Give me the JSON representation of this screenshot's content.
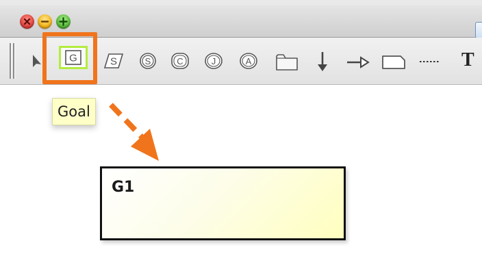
{
  "window": {
    "controls": [
      {
        "name": "close",
        "color": "#e0443e"
      },
      {
        "name": "minimize",
        "color": "#f4b41a"
      },
      {
        "name": "zoom",
        "color": "#5ab93a"
      }
    ]
  },
  "toolbar": {
    "tools": [
      {
        "name": "pointer",
        "icon": "pointer-arrow-icon"
      },
      {
        "name": "goal",
        "icon": "goal-g-box-icon",
        "letter": "G",
        "highlighted": true
      },
      {
        "name": "strategy",
        "icon": "strategy-s-parallelogram-icon",
        "letter": "S"
      },
      {
        "name": "solution",
        "icon": "solution-s-circle-icon",
        "letter": "S"
      },
      {
        "name": "context",
        "icon": "context-c-rounded-icon",
        "letter": "C"
      },
      {
        "name": "justification",
        "icon": "justification-j-oval-icon",
        "letter": "J"
      },
      {
        "name": "assumption",
        "icon": "assumption-a-oval-icon",
        "letter": "A"
      },
      {
        "name": "module",
        "icon": "module-folder-icon"
      },
      {
        "name": "supported-by",
        "icon": "solid-arrow-down-icon"
      },
      {
        "name": "in-context-of",
        "icon": "hollow-arrow-right-icon"
      },
      {
        "name": "note",
        "icon": "note-folded-corner-icon"
      },
      {
        "name": "dotted-link",
        "icon": "dotted-line-icon"
      },
      {
        "name": "text",
        "icon": "text-t-icon",
        "letter": "T"
      }
    ]
  },
  "tooltip": {
    "text": "Goal"
  },
  "canvas": {
    "goal_node": {
      "id_label": "G1"
    }
  },
  "colors": {
    "highlight_orange": "#f0741c",
    "button_focus_green": "#b3ec3f",
    "tooltip_bg": "#ffffc8",
    "node_fill": "#ffffbf"
  }
}
